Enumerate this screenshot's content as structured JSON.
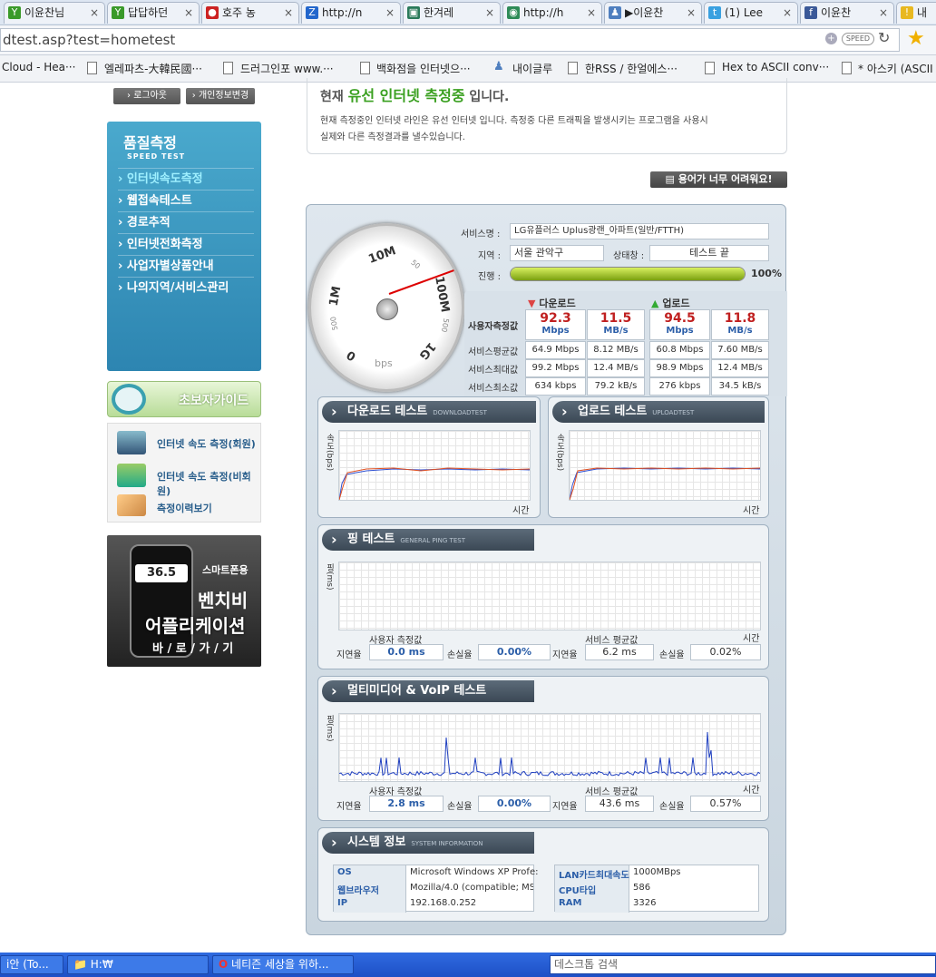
{
  "browser": {
    "tabs": [
      {
        "label": "이윤찬님",
        "icon": "Y",
        "color": "#3a9a2a"
      },
      {
        "label": "답답하던",
        "icon": "Y",
        "color": "#3a9a2a"
      },
      {
        "label": "호주 농",
        "icon": "●",
        "color": "#cc2222"
      },
      {
        "label": "http://n",
        "icon": "Z",
        "color": "#2266cc"
      },
      {
        "label": "한겨레",
        "icon": "▣",
        "color": "#2a7a5a"
      },
      {
        "label": "http://h",
        "icon": "◉",
        "color": "#2e8b57"
      },
      {
        "label": "▶이윤찬",
        "icon": "♟",
        "color": "#4f7fbf"
      },
      {
        "label": "(1) Lee",
        "icon": "t",
        "color": "#39a0e0"
      },
      {
        "label": "이윤찬",
        "icon": "f",
        "color": "#3b5998"
      },
      {
        "label": "내",
        "icon": "!",
        "color": "#e8b820"
      }
    ],
    "url": "dtest.asp?test=hometest",
    "speed_badge": "SPEED",
    "bookmarks": [
      "Cloud - Hea···",
      "엘레파츠-大韓民國···",
      "드러그인포 www.···",
      "백화점을 인터넷으···",
      "내이글루",
      "한RSS / 한얼에스···",
      "Hex to ASCII conv···",
      "* 아스키 (ASCII"
    ]
  },
  "sidebar": {
    "logout": "로그아웃",
    "profile": "개인정보변경",
    "nav_title": "품질측정",
    "nav_sub": "SPEED TEST",
    "nav_items": [
      "인터넷속도측정",
      "웹접속테스트",
      "경로추적",
      "인터넷전화측정",
      "사업자별상품안내",
      "나의지역/서비스관리"
    ],
    "guide_title": "초보자가이드",
    "guide_items": [
      "인터넷 속도 측정(회원)",
      "인터넷 속도 측정(비회원)",
      "측정이력보기"
    ],
    "banner": {
      "speed": "36.5",
      "tag": "스마트폰용",
      "line1": "벤치비",
      "line2": "어플리케이션",
      "cta": "바 / 로 / 가 / 기"
    }
  },
  "notice": {
    "title_pre": "현재",
    "title_em": "유선 인터넷 측정중",
    "title_post": "입니다.",
    "body1": "현재 측정중인 인터넷 라인은 유선 인터넷 입니다. 측정중 다른 트래픽을 발생시키는 프로그램을 사용시",
    "body2": "실제와 다른 측정결과를 낼수있습니다."
  },
  "help_button": "용어가 너무 어려워요!",
  "gauge": {
    "labels": [
      "10M",
      "50",
      "100M",
      "500",
      "1G",
      "bps",
      "0",
      "500",
      "1M"
    ]
  },
  "info": {
    "service_label": "서비스명 :",
    "service_value": "LG유플러스 Uplus광랜_아파트(일반/FTTH)",
    "region_label": "지역 :",
    "region_value": "서울 관악구",
    "status_label": "상태창 :",
    "status_value": "테스트 끝",
    "progress_label": "진행 :",
    "progress": 100,
    "progress_text": "100%"
  },
  "results": {
    "download_label": "다운로드",
    "upload_label": "업로드",
    "user_label": "사용자측정값",
    "dl_mbps": "92.3",
    "dl_mbps_unit": "Mbps",
    "dl_mbs": "11.5",
    "dl_mbs_unit": "MB/s",
    "ul_mbps": "94.5",
    "ul_mbps_unit": "Mbps",
    "ul_mbs": "11.8",
    "ul_mbs_unit": "MB/s",
    "rows": [
      {
        "label": "서비스평균값",
        "v": [
          "64.9 Mbps",
          "8.12 MB/s",
          "60.8 Mbps",
          "7.60 MB/s"
        ]
      },
      {
        "label": "서비스최대값",
        "v": [
          "99.2 Mbps",
          "12.4 MB/s",
          "98.9 Mbps",
          "12.4 MB/s"
        ]
      },
      {
        "label": "서비스최소값",
        "v": [
          "634 kbps",
          "79.2 kB/s",
          "276 kbps",
          "34.5 kB/s"
        ]
      }
    ]
  },
  "dl_test": {
    "title": "다운로드 테스트",
    "sub": "DOWNLOADTEST",
    "ylabel": "속도(bps)",
    "xlabel": "시간"
  },
  "ul_test": {
    "title": "업로드 테스트",
    "sub": "UPLOADTEST",
    "ylabel": "속도(bps)",
    "xlabel": "시간"
  },
  "ping": {
    "title": "핑 테스트",
    "sub": "GENERAL PING TEST",
    "ylabel": "핑(ms)",
    "xlabel": "시간",
    "user_caption": "사용자 측정값",
    "svc_caption": "서비스 평균값",
    "lat_label": "지연율",
    "loss_label": "손실율",
    "user_lat": "0.0 ms",
    "user_loss": "0.00%",
    "svc_lat": "6.2 ms",
    "svc_loss": "0.02%"
  },
  "voip": {
    "title": "멀티미디어 & VoIP 테스트",
    "ylabel": "핑(ms)",
    "xlabel": "시간",
    "user_caption": "사용자 측정값",
    "svc_caption": "서비스 평균값",
    "lat_label": "지연율",
    "loss_label": "손실율",
    "user_lat": "2.8 ms",
    "user_loss": "0.00%",
    "svc_lat": "43.6 ms",
    "svc_loss": "0.57%"
  },
  "system": {
    "title": "시스템 정보",
    "sub": "SYSTEM INFORMATION",
    "os_label": "OS",
    "os": "Microsoft Windows XP Profe:",
    "browser_label": "웹브라우저",
    "browser": "Mozilla/4.0 (compatible; MSII",
    "ip_label": "IP",
    "ip": "192.168.0.252",
    "lan_label": "LAN카드최대속도",
    "lan": "1000MBps",
    "cpu_label": "CPU타입",
    "cpu": "586",
    "ram_label": "RAM",
    "ram": "3326"
  },
  "taskbar": {
    "items": [
      "i안 (To...",
      "H:₩",
      "네티즌 세상을 위하..."
    ],
    "search": "데스크톱 검색"
  }
}
